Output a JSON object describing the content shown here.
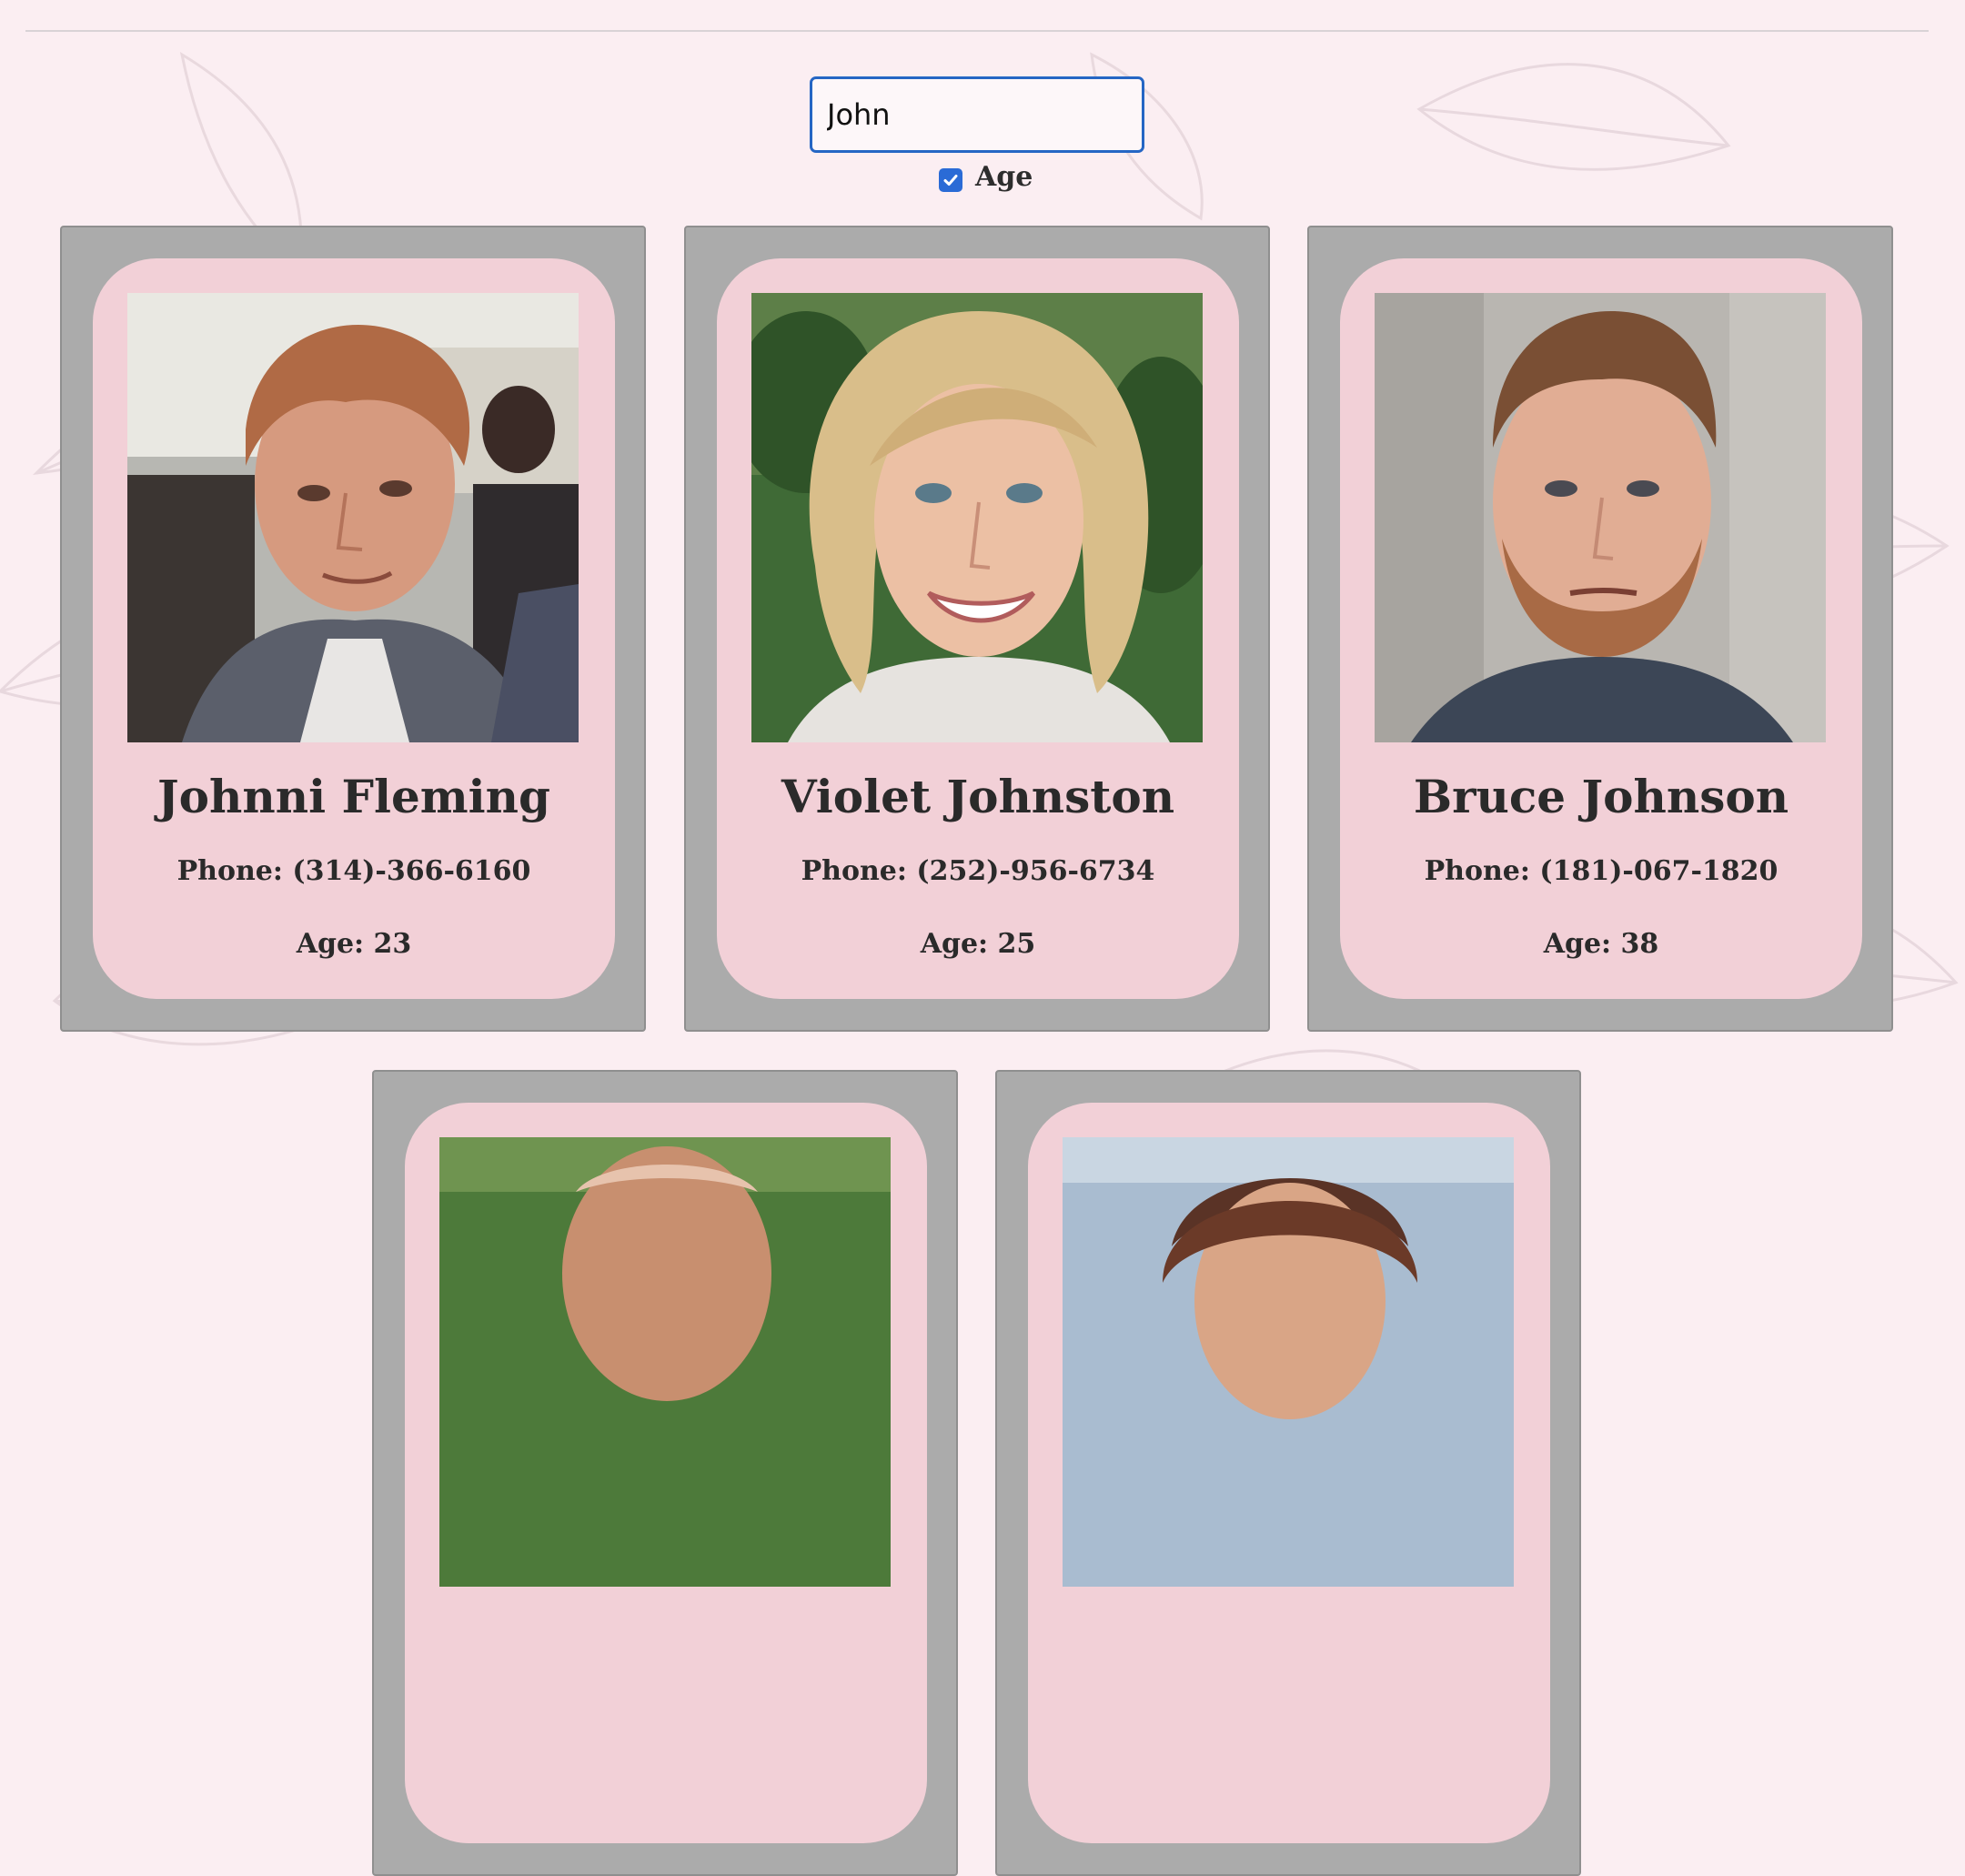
{
  "search": {
    "value": "John",
    "placeholder": ""
  },
  "filter": {
    "age_label": "Age",
    "age_checked": true
  },
  "colors": {
    "background": "#fbeef2",
    "card_frame": "#ababab",
    "card_inner": "#f2d0d7",
    "accent": "#2a6bd6"
  },
  "people": [
    {
      "name": "Johnni Fleming",
      "phone": "Phone: (314)-366-6160",
      "age": "Age: 23"
    },
    {
      "name": "Violet Johnston",
      "phone": "Phone: (252)-956-6734",
      "age": "Age: 25"
    },
    {
      "name": "Bruce Johnson",
      "phone": "Phone: (181)-067-1820",
      "age": "Age: 38"
    },
    {
      "name": "",
      "phone": "",
      "age": ""
    },
    {
      "name": "",
      "phone": "",
      "age": ""
    }
  ]
}
